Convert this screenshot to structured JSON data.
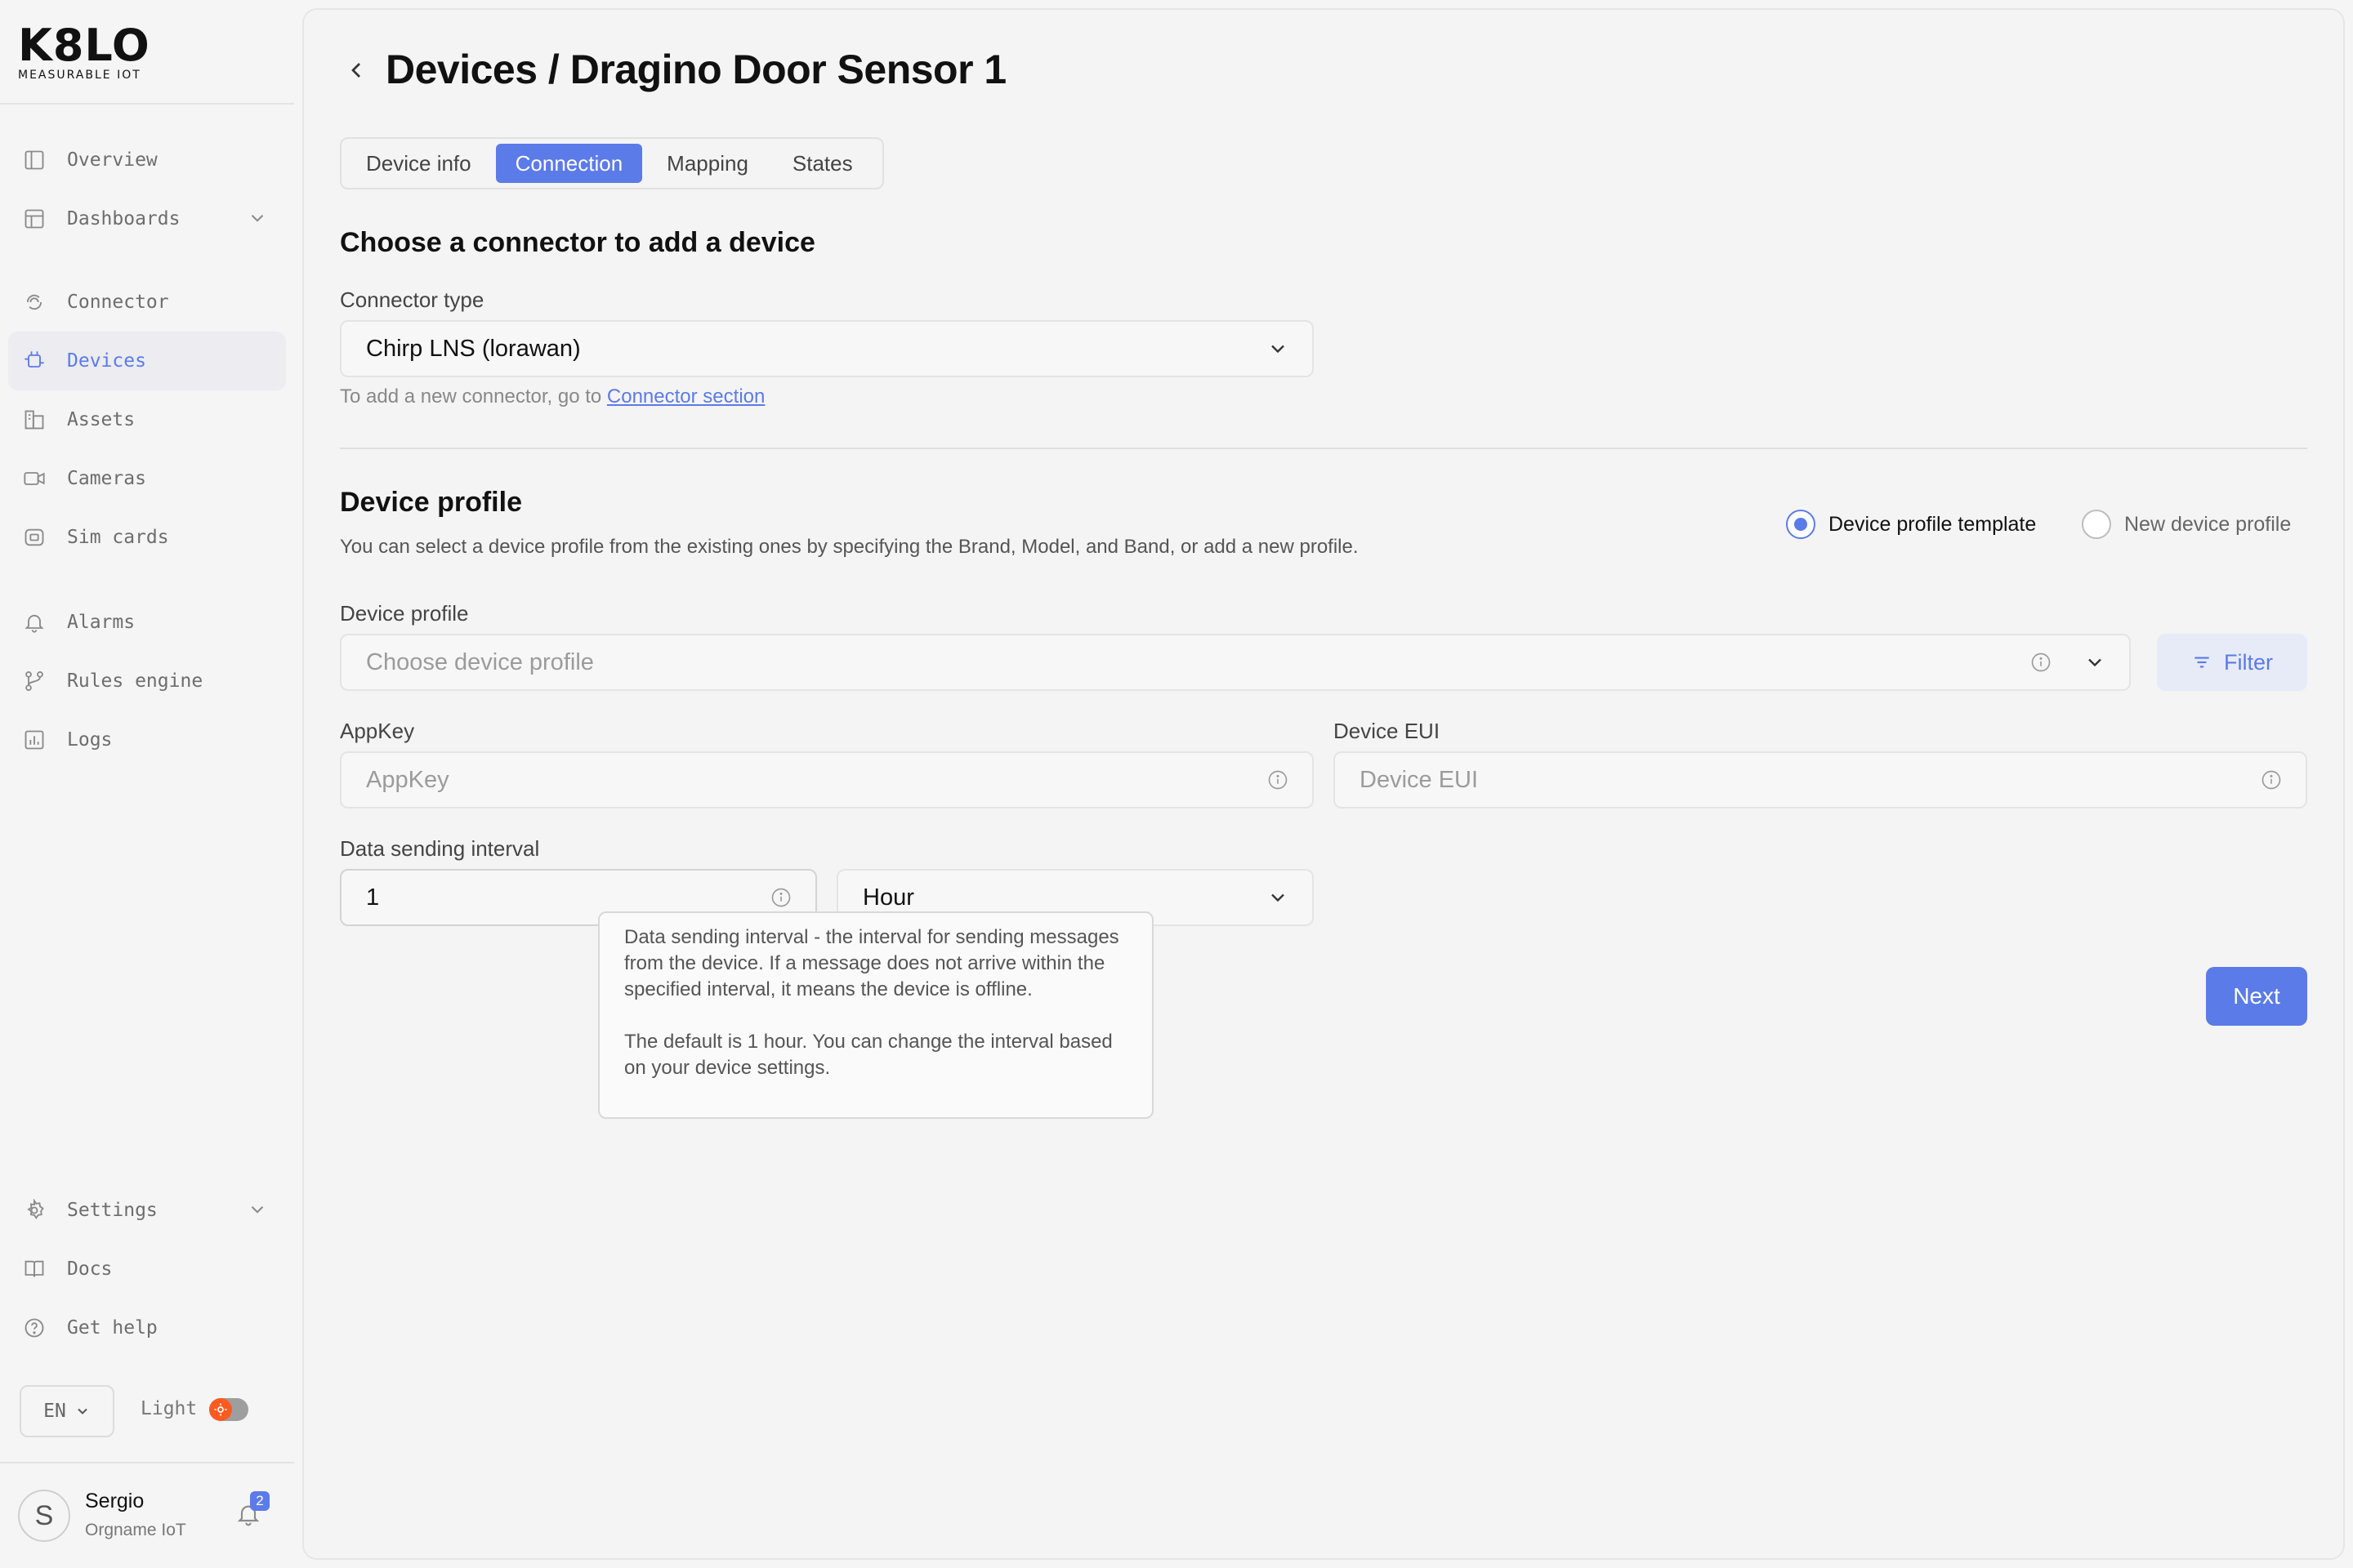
{
  "logo": {
    "main": "K8LO",
    "sub": "MEASURABLE IOT"
  },
  "sidebar": {
    "items": [
      {
        "label": "Overview",
        "icon": "overview-icon"
      },
      {
        "label": "Dashboards",
        "icon": "dashboards-icon",
        "expandable": true
      },
      {
        "label": "Connector",
        "icon": "connector-icon"
      },
      {
        "label": "Devices",
        "icon": "devices-icon",
        "active": true
      },
      {
        "label": "Assets",
        "icon": "assets-icon"
      },
      {
        "label": "Cameras",
        "icon": "camera-icon"
      },
      {
        "label": "Sim cards",
        "icon": "sim-card-icon"
      },
      {
        "label": "Alarms",
        "icon": "bell-icon"
      },
      {
        "label": "Rules engine",
        "icon": "rules-engine-icon"
      },
      {
        "label": "Logs",
        "icon": "logs-icon"
      }
    ],
    "bottom_items": [
      {
        "label": "Settings",
        "icon": "gear-icon",
        "expandable": true
      },
      {
        "label": "Docs",
        "icon": "book-icon"
      },
      {
        "label": "Get help",
        "icon": "help-icon"
      }
    ],
    "language": "EN",
    "theme_label": "Light",
    "user": {
      "initial": "S",
      "name": "Sergio",
      "org": "Orgname IoT",
      "notifications": "2"
    }
  },
  "header": {
    "title": "Devices / Dragino Door Sensor 1"
  },
  "tabs": [
    {
      "label": "Device info"
    },
    {
      "label": "Connection",
      "active": true
    },
    {
      "label": "Mapping"
    },
    {
      "label": "States"
    }
  ],
  "connector": {
    "section_title": "Choose a connector to add a device",
    "type_label": "Connector type",
    "type_value": "Chirp LNS (lorawan)",
    "helper_prefix": "To add a new connector, go to",
    "helper_link": "Connector section"
  },
  "profile": {
    "section_title": "Device profile",
    "description": "You can select a device profile from the existing ones by specifying the Brand, Model, and Band, or add a new profile.",
    "radio_template": "Device profile template",
    "radio_new": "New device profile",
    "selected_radio": "template",
    "profile_label": "Device profile",
    "profile_placeholder": "Choose device profile",
    "filter_label": "Filter",
    "appkey_label": "AppKey",
    "appkey_placeholder": "AppKey",
    "eui_label": "Device EUI",
    "eui_placeholder": "Device EUI",
    "interval_label": "Data sending interval",
    "interval_value": "1",
    "interval_unit": "Hour",
    "tooltip_p1": "Data sending interval - the interval for sending messages from the device. If a message does not arrive within the specified interval, it means the device is offline.",
    "tooltip_p2": "The default is 1 hour. You can change the interval based on your device settings."
  },
  "actions": {
    "next_label": "Next"
  },
  "colors": {
    "accent": "#5b7be8",
    "background": "#f5f5f5",
    "toggle_knob": "#ff5a1f"
  }
}
